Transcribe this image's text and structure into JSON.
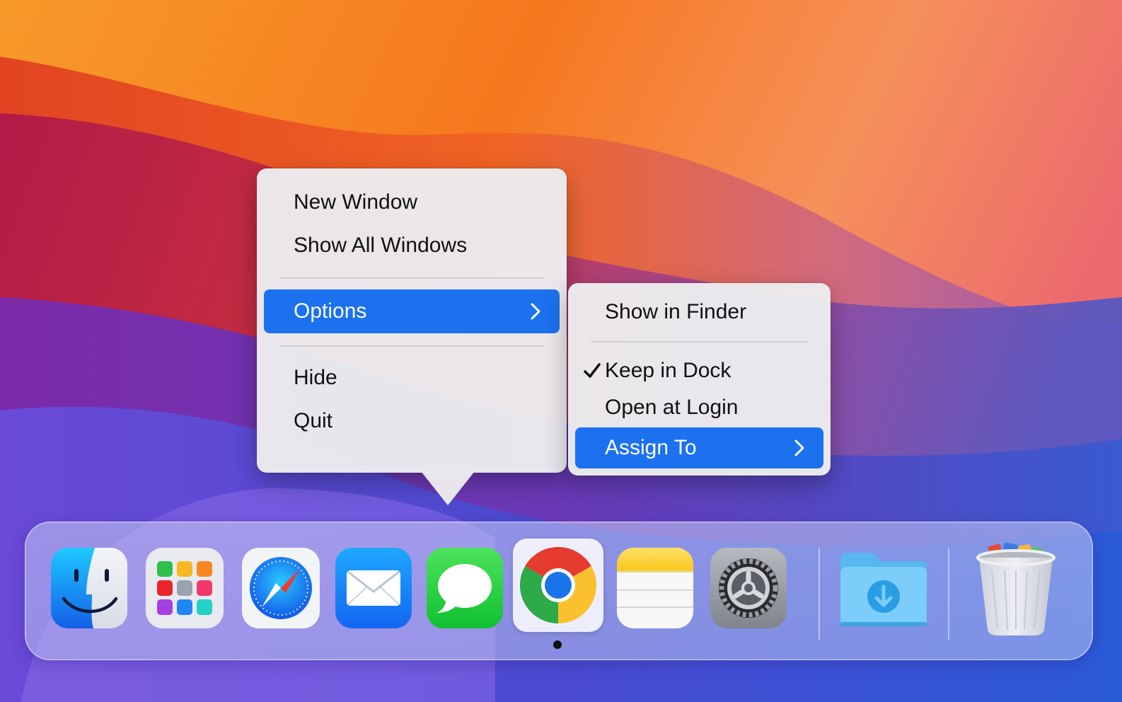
{
  "main_menu": {
    "items": [
      {
        "label": "New Window"
      },
      {
        "label": "Show All Windows"
      },
      {
        "label": "Options",
        "selected": true,
        "has_submenu": true
      },
      {
        "label": "Hide"
      },
      {
        "label": "Quit"
      }
    ]
  },
  "sub_menu": {
    "items": [
      {
        "label": "Show in Finder"
      },
      {
        "label": "Keep in Dock",
        "checked": true
      },
      {
        "label": "Open at Login"
      },
      {
        "label": "Assign To",
        "selected": true,
        "has_submenu": true
      }
    ]
  },
  "dock": {
    "apps": [
      {
        "name": "Finder",
        "icon": "finder-icon"
      },
      {
        "name": "Launchpad",
        "icon": "launchpad-icon"
      },
      {
        "name": "Safari",
        "icon": "safari-icon"
      },
      {
        "name": "Mail",
        "icon": "mail-icon"
      },
      {
        "name": "Messages",
        "icon": "messages-icon"
      },
      {
        "name": "Google Chrome",
        "icon": "chrome-icon",
        "running": true
      },
      {
        "name": "Notes",
        "icon": "notes-icon"
      },
      {
        "name": "System Settings",
        "icon": "settings-gear-icon"
      },
      {
        "name": "Downloads",
        "icon": "downloads-folder-icon"
      },
      {
        "name": "Trash",
        "icon": "trash-icon"
      }
    ]
  },
  "colors": {
    "selection": "#1c71ee",
    "menu_background": "#ececee"
  }
}
